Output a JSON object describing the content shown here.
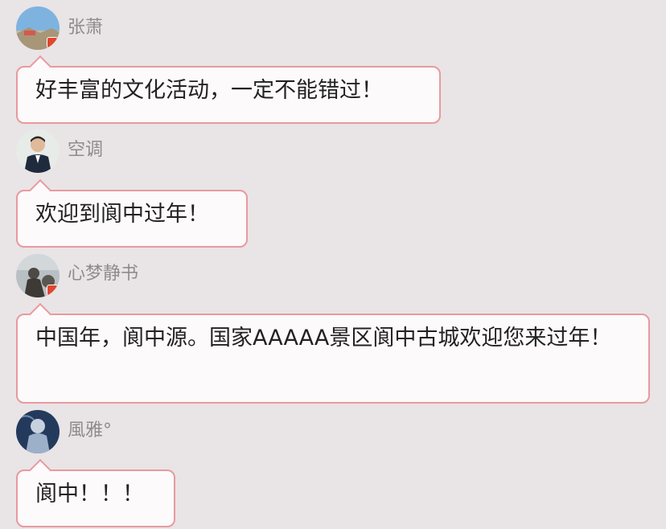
{
  "messages": [
    {
      "user": "张萧",
      "text": "好丰富的文化活动，一定不能错过！",
      "avatar_icon": "landscape-avatar-icon"
    },
    {
      "user": "空调",
      "text": "欢迎到阆中过年！",
      "avatar_icon": "person-suit-avatar-icon"
    },
    {
      "user": "心梦静书",
      "text": "中国年，阆中源。国家AAAAA景区阆中古城欢迎您来过年！",
      "avatar_icon": "statue-avatar-icon"
    },
    {
      "user": "風雅°",
      "text": "阆中！！！",
      "avatar_icon": "painting-avatar-icon"
    }
  ],
  "colors": {
    "background": "#e9e4e6",
    "bubble_border": "#e79a9f",
    "bubble_fill": "#fdfafb",
    "username": "#8f8b8d",
    "badge": "#e0472f"
  }
}
